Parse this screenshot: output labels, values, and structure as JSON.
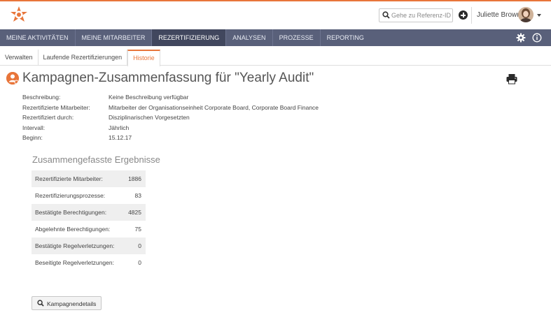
{
  "header": {
    "search_placeholder": "Gehe zu Referenz-ID",
    "user_name": "Juliette Brown"
  },
  "main_nav": {
    "items": [
      {
        "label": "MEINE AKTIVITÄTEN",
        "active": false
      },
      {
        "label": "MEINE MITARBEITER",
        "active": false
      },
      {
        "label": "REZERTIFIZIERUNG",
        "active": true
      },
      {
        "label": "ANALYSEN",
        "active": false
      },
      {
        "label": "PROZESSE",
        "active": false
      },
      {
        "label": "REPORTING",
        "active": false
      }
    ]
  },
  "sub_nav": {
    "items": [
      {
        "label": "Verwalten",
        "active": false
      },
      {
        "label": "Laufende Rezertifizierungen",
        "active": false
      },
      {
        "label": "Historie",
        "active": true
      }
    ]
  },
  "page": {
    "title": "Kampagnen-Zusammenfassung für \"Yearly Audit\""
  },
  "details": [
    {
      "label": "Beschreibung:",
      "value": "Keine Beschreibung verfügbar"
    },
    {
      "label": "Rezertifizierte Mitarbeiter:",
      "value": "Mitarbeiter der Organisationseinheit Corporate Board, Corporate Board Finance"
    },
    {
      "label": "Rezertifiziert durch:",
      "value": "Disziplinarischen Vorgesetzten"
    },
    {
      "label": "Intervall:",
      "value": "Jährlich"
    },
    {
      "label": "Beginn:",
      "value": "15.12.17"
    }
  ],
  "results": {
    "title": "Zusammengefasste Ergebnisse",
    "rows": [
      {
        "label": "Rezertifizierte Mitarbeiter:",
        "value": "1886"
      },
      {
        "label": "Rezertifizierungsprozesse:",
        "value": "83"
      },
      {
        "label": "Bestätigte Berechtigungen:",
        "value": "4825"
      },
      {
        "label": "Abgelehnte Berechtigungen:",
        "value": "75"
      },
      {
        "label": "Bestätigte Regelverletzungen:",
        "value": "0"
      },
      {
        "label": "Beseitigte Regelverletzungen:",
        "value": "0"
      }
    ]
  },
  "actions": {
    "details_button_label": "Kampagnendetails"
  },
  "colors": {
    "accent": "#e8753a",
    "nav_bg": "#59607a",
    "nav_active": "#41475e"
  },
  "icons": {
    "logo": "star-target-logo",
    "search": "search-icon",
    "plus": "plus-circle-icon",
    "user": "avatar",
    "settings": "gear-icon",
    "info": "info-icon",
    "title": "user-badge-icon",
    "print": "printer-icon",
    "details": "search-icon"
  }
}
